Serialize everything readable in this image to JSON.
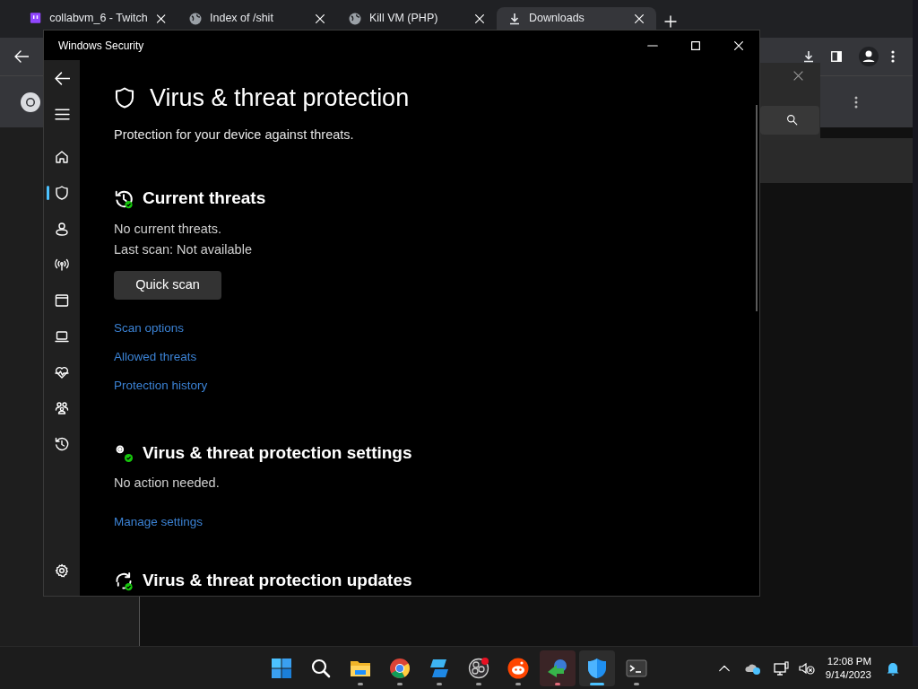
{
  "browser": {
    "tabs": [
      {
        "label": "collabvm_6 - Twitch",
        "selected": false
      },
      {
        "label": "Index of /shit",
        "selected": false
      },
      {
        "label": "Kill VM (PHP)",
        "selected": false
      },
      {
        "label": "Downloads",
        "selected": true
      }
    ]
  },
  "window": {
    "title": "Windows Security",
    "nav": [
      {
        "selected": false
      },
      {
        "selected": true
      },
      {
        "selected": false
      },
      {
        "selected": false
      },
      {
        "selected": false
      },
      {
        "selected": false
      },
      {
        "selected": false
      },
      {
        "selected": false
      },
      {
        "selected": false
      }
    ],
    "heading": "Virus & threat protection",
    "subtitle": "Protection for your device against threats.",
    "sections": [
      {
        "heading": "Current threats",
        "lines": [
          "No current threats.",
          "Last scan: Not available"
        ],
        "button": "Quick scan",
        "links": [
          "Scan options",
          "Allowed threats",
          "Protection history"
        ]
      },
      {
        "heading": "Virus & threat protection settings",
        "lines": [
          "No action needed."
        ],
        "links": [
          "Manage settings"
        ]
      },
      {
        "heading": "Virus & threat protection updates"
      }
    ]
  },
  "taskbar": {
    "apps": [
      {
        "running": false,
        "active": false,
        "attention": false
      },
      {
        "running": false,
        "active": false,
        "attention": false
      },
      {
        "running": true,
        "active": false,
        "attention": false
      },
      {
        "running": true,
        "active": false,
        "attention": false
      },
      {
        "running": true,
        "active": false,
        "attention": false
      },
      {
        "running": true,
        "active": false,
        "attention": false
      },
      {
        "running": true,
        "active": false,
        "attention": false
      },
      {
        "running": true,
        "active": false,
        "attention": true
      },
      {
        "running": true,
        "active": true,
        "attention": false
      },
      {
        "running": true,
        "active": false,
        "attention": false
      }
    ],
    "time": "12:08 PM",
    "date": "9/14/2023"
  }
}
